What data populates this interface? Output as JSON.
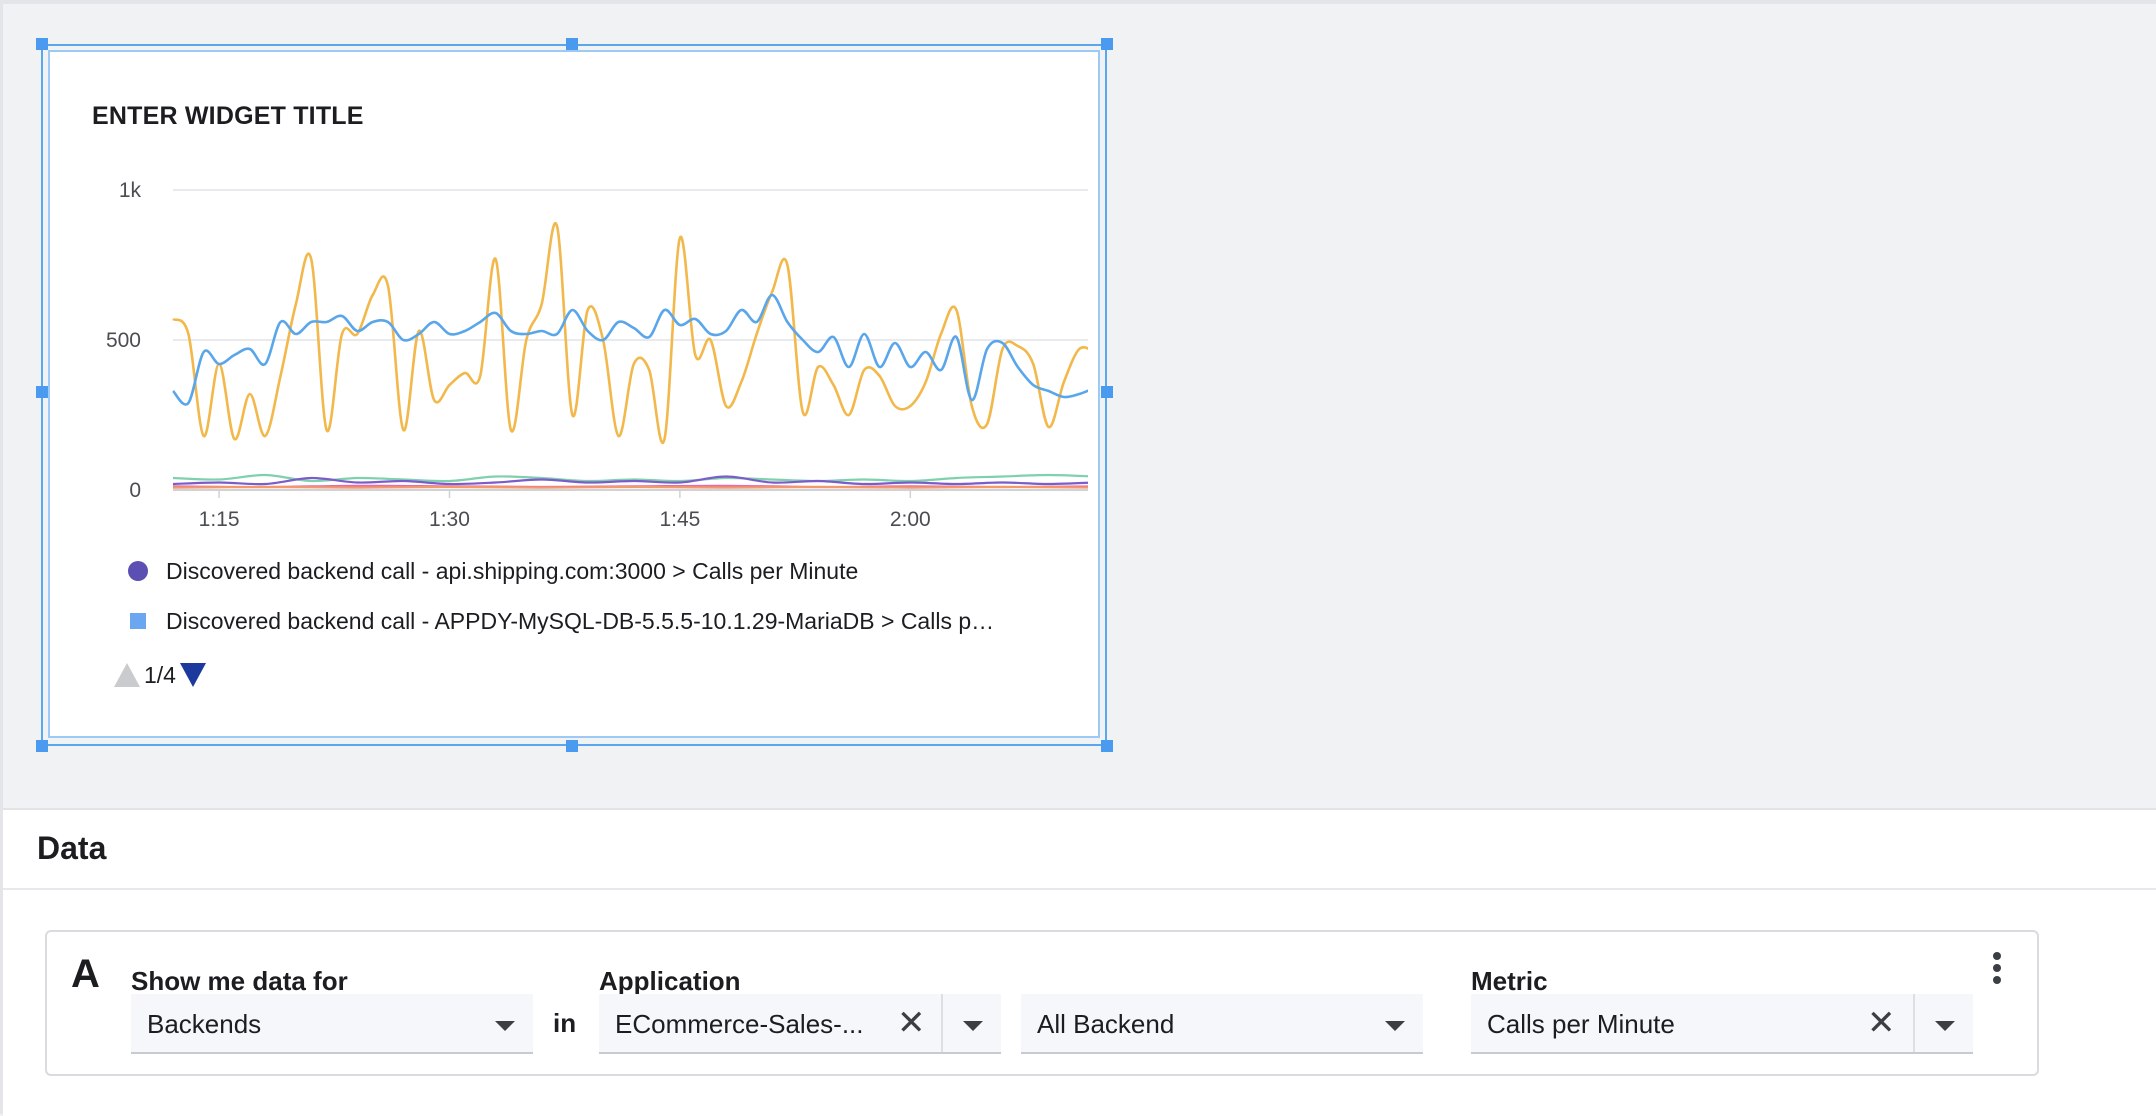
{
  "widget": {
    "title": "ENTER WIDGET TITLE",
    "legend": [
      {
        "label": "Discovered backend call - api.shipping.com:3000 > Calls per Minute",
        "color": "#5b4fb4",
        "marker": "circle"
      },
      {
        "label": "Discovered backend call - APPDY-MySQL-DB-5.5.5-10.1.29-MariaDB > Calls p…",
        "color": "#6aa7f0",
        "marker": "square"
      }
    ],
    "pager": {
      "text": "1/4"
    }
  },
  "chart_data": {
    "type": "line",
    "yticks": [
      "0",
      "500",
      "1k"
    ],
    "ylim": [
      0,
      1000
    ],
    "xticks": [
      "1:15",
      "1:30",
      "1:45",
      "2:00"
    ],
    "xlim_minutes_after_1": [
      12,
      73
    ],
    "grid": true,
    "series": [
      {
        "color": "#f2b84b",
        "x": [
          12,
          13,
          14,
          15,
          16,
          17,
          18,
          19,
          20,
          21,
          22,
          23,
          24,
          25,
          26,
          27,
          28,
          29,
          30,
          31,
          32,
          33,
          34,
          35,
          36,
          37,
          38,
          39,
          40,
          41,
          42,
          43,
          44,
          45,
          46,
          47,
          48,
          49,
          50,
          51,
          52,
          53,
          54,
          55,
          56,
          57,
          58,
          59,
          60,
          61,
          62,
          63,
          64,
          65,
          66,
          67,
          68,
          69,
          70,
          71,
          72
        ],
        "y": [
          570,
          520,
          180,
          420,
          170,
          320,
          180,
          380,
          620,
          770,
          200,
          520,
          520,
          650,
          680,
          200,
          530,
          300,
          350,
          390,
          380,
          770,
          200,
          500,
          620,
          880,
          250,
          600,
          500,
          180,
          420,
          400,
          170,
          840,
          450,
          500,
          280,
          360,
          520,
          660,
          750,
          260,
          410,
          350,
          250,
          400,
          380,
          280,
          280,
          360,
          520,
          600,
          280,
          220,
          470,
          480,
          420,
          210,
          360,
          470,
          460
        ]
      },
      {
        "color": "#5aa6ea",
        "x": [
          12,
          13,
          14,
          15,
          16,
          17,
          18,
          19,
          20,
          21,
          22,
          23,
          24,
          25,
          26,
          27,
          28,
          29,
          30,
          31,
          32,
          33,
          34,
          35,
          36,
          37,
          38,
          39,
          40,
          41,
          42,
          43,
          44,
          45,
          46,
          47,
          48,
          49,
          50,
          51,
          52,
          53,
          54,
          55,
          56,
          57,
          58,
          59,
          60,
          61,
          62,
          63,
          64,
          65,
          66,
          67,
          68,
          69,
          70,
          71,
          72
        ],
        "y": [
          330,
          290,
          460,
          420,
          450,
          470,
          420,
          560,
          520,
          560,
          560,
          580,
          530,
          560,
          560,
          500,
          520,
          560,
          520,
          530,
          560,
          590,
          530,
          520,
          530,
          520,
          600,
          530,
          500,
          560,
          540,
          510,
          600,
          550,
          570,
          520,
          530,
          600,
          560,
          650,
          560,
          500,
          460,
          510,
          410,
          520,
          410,
          490,
          410,
          460,
          400,
          510,
          300,
          470,
          490,
          410,
          350,
          330,
          310,
          320,
          340
        ]
      },
      {
        "color": "#7fd0ac",
        "x": [
          12,
          15,
          18,
          21,
          24,
          27,
          30,
          33,
          36,
          39,
          42,
          45,
          48,
          51,
          54,
          57,
          60,
          63,
          66,
          69,
          72
        ],
        "y": [
          40,
          35,
          50,
          30,
          40,
          35,
          30,
          45,
          40,
          30,
          35,
          30,
          40,
          35,
          30,
          35,
          30,
          40,
          45,
          50,
          45
        ]
      },
      {
        "color": "#7b5cc9",
        "x": [
          12,
          15,
          18,
          21,
          24,
          27,
          30,
          33,
          36,
          39,
          42,
          45,
          48,
          51,
          54,
          57,
          60,
          63,
          66,
          69,
          72
        ],
        "y": [
          20,
          25,
          20,
          40,
          25,
          30,
          20,
          25,
          35,
          25,
          30,
          25,
          45,
          25,
          30,
          20,
          25,
          20,
          25,
          20,
          25
        ]
      },
      {
        "color": "#e86aa8",
        "x": [
          12,
          18,
          24,
          30,
          36,
          42,
          48,
          54,
          60,
          66,
          72
        ],
        "y": [
          12,
          10,
          14,
          12,
          10,
          12,
          14,
          10,
          12,
          10,
          12
        ]
      },
      {
        "color": "#f29a6b",
        "x": [
          12,
          18,
          24,
          30,
          36,
          42,
          48,
          54,
          60,
          66,
          72
        ],
        "y": [
          8,
          10,
          8,
          10,
          8,
          10,
          8,
          10,
          8,
          10,
          8
        ]
      }
    ]
  },
  "data_section": {
    "heading": "Data",
    "row_letter": "A",
    "show_label": "Show me data for",
    "show_value": "Backends",
    "in_word": "in",
    "application_label": "Application",
    "application_value": "ECommerce-Sales-...",
    "backend_value": "All Backend",
    "metric_label": "Metric",
    "metric_value": "Calls per Minute"
  }
}
